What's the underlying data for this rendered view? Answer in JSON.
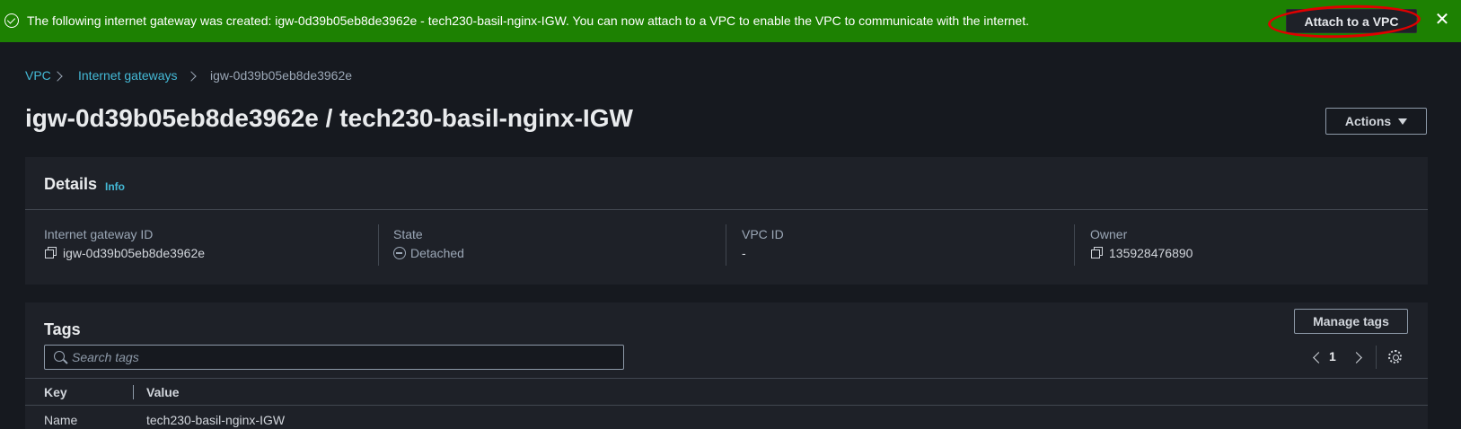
{
  "flash": {
    "message": "The following internet gateway was created: igw-0d39b05eb8de3962e - tech230-basil-nginx-IGW. You can now attach to a VPC to enable the VPC to communicate with the internet.",
    "button_label": "Attach to a VPC",
    "close": "✕",
    "bg_color": "#1d8102"
  },
  "breadcrumb": {
    "items": [
      "VPC",
      "Internet gateways",
      "igw-0d39b05eb8de3962e"
    ]
  },
  "page": {
    "title": "igw-0d39b05eb8de3962e / tech230-basil-nginx-IGW",
    "actions_label": "Actions"
  },
  "details": {
    "heading": "Details",
    "info_label": "Info",
    "columns": [
      {
        "label": "Internet gateway ID",
        "value": "igw-0d39b05eb8de3962e"
      },
      {
        "label": "State",
        "value": "Detached"
      },
      {
        "label": "VPC ID",
        "value": "-"
      },
      {
        "label": "Owner",
        "value": "135928476890"
      }
    ]
  },
  "tags": {
    "heading": "Tags",
    "manage_label": "Manage tags",
    "search_placeholder": "Search tags",
    "page_number": "1",
    "headers": [
      "Key",
      "Value"
    ],
    "rows": [
      {
        "key": "Name",
        "value": "tech230-basil-nginx-IGW"
      }
    ]
  }
}
